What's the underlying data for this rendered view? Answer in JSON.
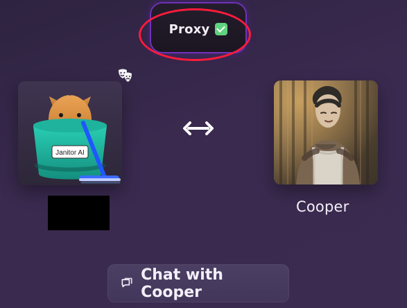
{
  "proxy_badge": {
    "label": "Proxy"
  },
  "left_character": {
    "badge_text": "Janitor AI"
  },
  "right_character": {
    "name": "Cooper"
  },
  "actions": {
    "chat_button_label": "Chat with Cooper"
  },
  "icons": {
    "proxy_status": "check-icon",
    "persona": "mask-icon",
    "swap": "double-arrow-icon",
    "chat": "chat-bubble-icon"
  },
  "colors": {
    "background_top": "#2e2340",
    "background_bottom": "#3b2b50",
    "proxy_glow": "#9b3cff",
    "check_green": "#5fd37f",
    "highlight_red": "#ff1b3b",
    "button_bg": "#4b3f63",
    "text": "#f2eff8"
  }
}
